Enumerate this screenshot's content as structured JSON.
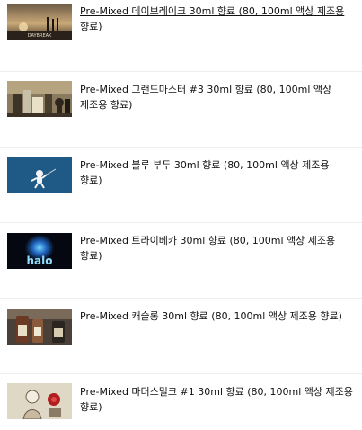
{
  "products": [
    {
      "title": "Pre-Mixed 데이브레이크 30ml 향료 (80, 100ml 액상 제조용 향료)",
      "image_icon": "daybreak-thumbnail-icon",
      "image_caption": "DAYBREAK",
      "hovered": true
    },
    {
      "title": "Pre-Mixed 그랜드마스터 #3 30ml 향료 (80, 100ml 액상 제조용 향료)",
      "image_icon": "grandmaster-thumbnail-icon",
      "hovered": false
    },
    {
      "title": "Pre-Mixed 블루 부두 30ml 향료 (80, 100ml 액상 제조용 향료)",
      "image_icon": "blue-voodoo-thumbnail-icon",
      "hovered": false
    },
    {
      "title": "Pre-Mixed 트라이베카 30ml 향료 (80, 100ml 액상 제조용 향료)",
      "image_icon": "tribeca-halo-thumbnail-icon",
      "image_caption": "halo",
      "hovered": false
    },
    {
      "title": "Pre-Mixed 캐슬롱 30ml 향료 (80, 100ml 액상 제조용 향료)",
      "image_icon": "castle-long-thumbnail-icon",
      "hovered": false
    },
    {
      "title": "Pre-Mixed 마더스밀크 #1 30ml 향료 (80, 100ml 액상 제조용 향료)",
      "image_icon": "mothers-milk-thumbnail-icon",
      "hovered": false
    }
  ]
}
